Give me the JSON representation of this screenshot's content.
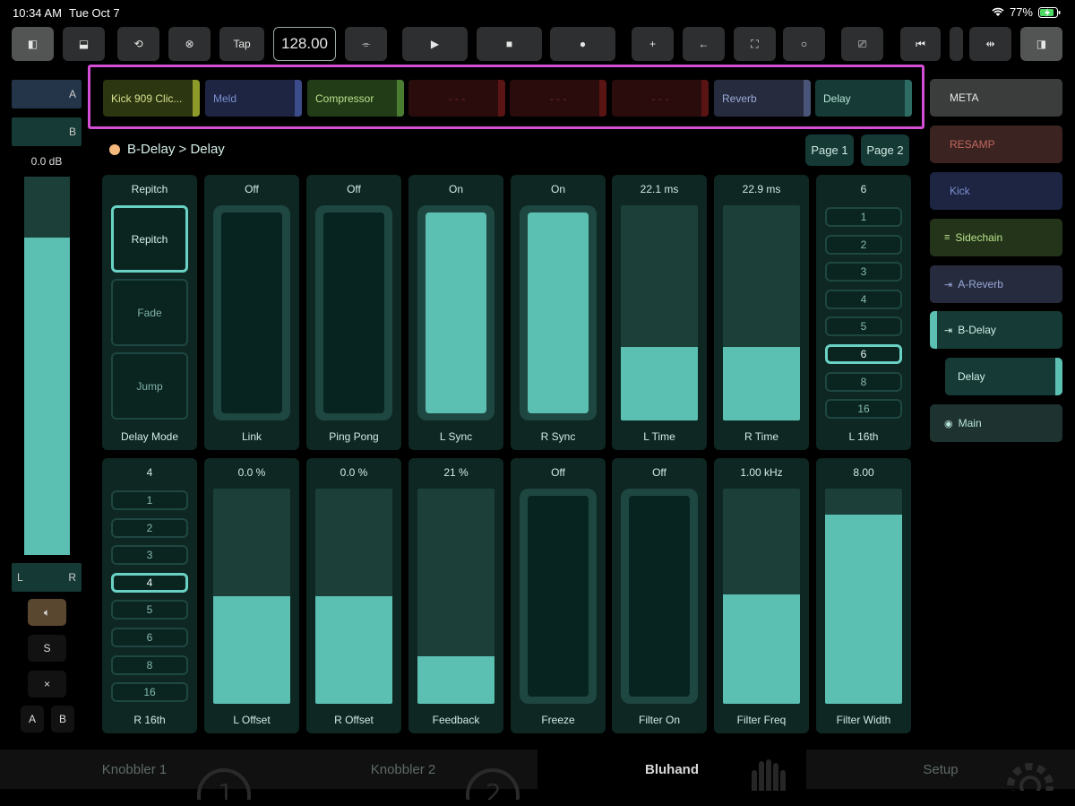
{
  "status": {
    "time": "10:34 AM",
    "date": "Tue Oct 7",
    "battery": "77%"
  },
  "toolbar": {
    "tap_label": "Tap",
    "bpm": "128.00",
    "buttons": [
      "sidebar-left-icon",
      "panel-bottom-icon",
      "loop-icon",
      "close-circle-icon",
      "tap",
      "bpm",
      "cassette-icon",
      "play-icon",
      "stop-icon",
      "record-icon",
      "plus-icon",
      "back-arrow-icon",
      "fullscreen-icon",
      "circle-icon",
      "cast-icon",
      "skip-back-icon",
      "split-icon",
      "sidebar-right-icon"
    ]
  },
  "devices": [
    {
      "name": "Kick 909 Clic...",
      "bg": "#2c3610",
      "fg": "#d7e08f",
      "bar": "#8e9a2a"
    },
    {
      "name": "Meld",
      "bg": "#1e2542",
      "fg": "#7b8fd1",
      "bar": "#3c4c8a"
    },
    {
      "name": "Compressor",
      "bg": "#223c18",
      "fg": "#b7e08a",
      "bar": "#4a7d32"
    },
    {
      "name": "- - -",
      "bg": "#2a0c0c",
      "fg": "#6e2b2b",
      "bar": "#5a1414"
    },
    {
      "name": "- - -",
      "bg": "#2a0c0c",
      "fg": "#6e2b2b",
      "bar": "#5a1414"
    },
    {
      "name": "- - -",
      "bg": "#2a0c0c",
      "fg": "#6e2b2b",
      "bar": "#5a1414"
    },
    {
      "name": "Reverb",
      "bg": "#262c3e",
      "fg": "#9aa8d8",
      "bar": "#4a5478"
    },
    {
      "name": "Delay",
      "bg": "#163a35",
      "fg": "#b8e3da",
      "bar": "#2e6b62"
    }
  ],
  "left": {
    "a_label": "A",
    "b_label": "B",
    "volume": "0.0 dB",
    "volume_level": 0.84,
    "pan_l": "L",
    "pan_r": "R",
    "solo": "S",
    "close": "×",
    "ab_a": "A",
    "ab_b": "B"
  },
  "header": {
    "breadcrumb": "B-Delay > Delay",
    "page1": "Page 1",
    "page2": "Page 2"
  },
  "row1": [
    {
      "type": "radio3",
      "value": "Repitch",
      "label": "Delay Mode",
      "options": [
        "Repitch",
        "Fade",
        "Jump"
      ],
      "selected": 0
    },
    {
      "type": "toggle",
      "value": "Off",
      "label": "Link",
      "on": false
    },
    {
      "type": "toggle",
      "value": "Off",
      "label": "Ping Pong",
      "on": false
    },
    {
      "type": "toggle",
      "value": "On",
      "label": "L Sync",
      "on": true
    },
    {
      "type": "toggle",
      "value": "On",
      "label": "R Sync",
      "on": true
    },
    {
      "type": "slider",
      "value": "22.1 ms",
      "label": "L Time",
      "level": 0.34
    },
    {
      "type": "slider",
      "value": "22.9 ms",
      "label": "R Time",
      "level": 0.34
    },
    {
      "type": "seg",
      "value": "6",
      "label": "L 16th",
      "options": [
        "1",
        "2",
        "3",
        "4",
        "5",
        "6",
        "8",
        "16"
      ],
      "selected": 5
    }
  ],
  "row2": [
    {
      "type": "seg",
      "value": "4",
      "label": "R 16th",
      "options": [
        "1",
        "2",
        "3",
        "4",
        "5",
        "6",
        "8",
        "16"
      ],
      "selected": 3
    },
    {
      "type": "slider",
      "value": "0.0 %",
      "label": "L Offset",
      "level": 0.5
    },
    {
      "type": "slider",
      "value": "0.0 %",
      "label": "R Offset",
      "level": 0.5
    },
    {
      "type": "slider",
      "value": "21 %",
      "label": "Feedback",
      "level": 0.22
    },
    {
      "type": "toggle",
      "value": "Off",
      "label": "Freeze",
      "on": false
    },
    {
      "type": "toggle",
      "value": "Off",
      "label": "Filter On",
      "on": false
    },
    {
      "type": "slider",
      "value": "1.00 kHz",
      "label": "Filter Freq",
      "level": 0.51
    },
    {
      "type": "slider",
      "value": "8.00",
      "label": "Filter Width",
      "level": 0.88
    }
  ],
  "tracks": [
    {
      "name": "META",
      "bg": "#3b3c3c",
      "fg": "#e8e8e8",
      "icon": ""
    },
    {
      "name": "RESAMP",
      "bg": "#3a2321",
      "fg": "#c2675e",
      "icon": ""
    },
    {
      "name": "Kick",
      "bg": "#1e2542",
      "fg": "#7b8fd1",
      "icon": ""
    },
    {
      "name": "Sidechain",
      "bg": "#24341a",
      "fg": "#b7e08a",
      "icon": "≡"
    },
    {
      "name": "A-Reverb",
      "bg": "#262c3e",
      "fg": "#9aa8d8",
      "icon": "⇥"
    },
    {
      "name": "B-Delay",
      "bg": "#163a35",
      "fg": "#d0efe8",
      "icon": "⇥"
    },
    {
      "name": "Delay",
      "bg": "#163a35",
      "fg": "#d0efe8",
      "icon": ""
    },
    {
      "name": "Main",
      "bg": "#1e3330",
      "fg": "#b8e3da",
      "icon": "◉"
    }
  ],
  "tabs": [
    "Knobbler 1",
    "Knobbler 2",
    "Bluhand",
    "Setup"
  ],
  "active_tab": 2
}
